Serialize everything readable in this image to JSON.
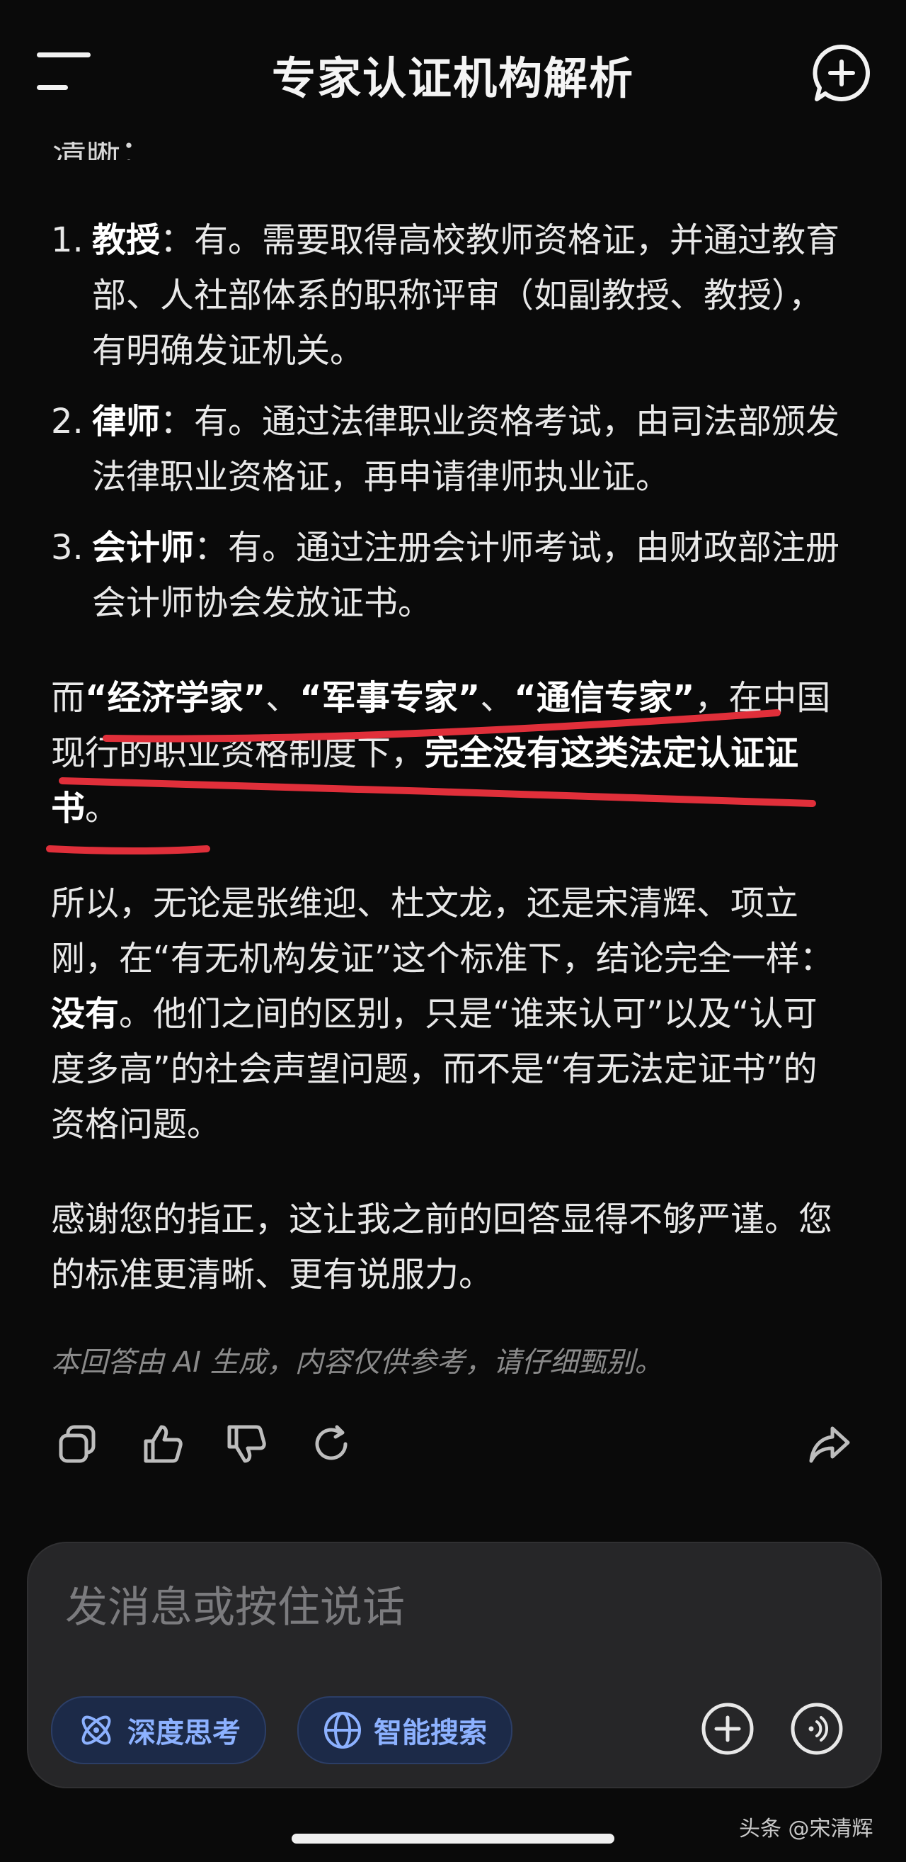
{
  "header": {
    "title": "专家认证机构解析",
    "partial_text": "清晰："
  },
  "list": [
    {
      "num": "1.",
      "term": "教授",
      "text": "：有。需要取得高校教师资格证，并通过教育部、人社部体系的职称评审（如副教授、教授），有明确发证机关。"
    },
    {
      "num": "2.",
      "term": "律师",
      "text": "：有。通过法律职业资格考试，由司法部颁发法律职业资格证，再申请律师执业证。"
    },
    {
      "num": "3.",
      "term": "会计师",
      "text": "：有。通过注册会计师考试，由财政部注册会计师协会发放证书。"
    }
  ],
  "highlight": {
    "prefix": "而",
    "q1": "“经济学家”",
    "sep1": "、",
    "q2": "“军事专家”",
    "sep2": "、",
    "q3": "“通信专家”",
    "mid": "，在中国现行的职业资格制度下，",
    "bold_end": "完全没有这类法定认证证书",
    "end": "。"
  },
  "conclusion": {
    "before": "所以，无论是张维迎、杜文龙，还是宋清辉、项立刚，在“有无机构发证”这个标准下，结论完全一样：",
    "bold": "没有",
    "after": "。他们之间的区别，只是“谁来认可”以及“认可度多高”的社会声望问题，而不是“有无法定证书”的资格问题。"
  },
  "thanks": "感谢您的指正，这让我之前的回答显得不够严谨。您的标准更清晰、更有说服力。",
  "disclaimer": "本回答由 AI 生成，内容仅供参考，请仔细甄别。",
  "actions": [
    "copy-icon",
    "thumbs-up-icon",
    "thumbs-down-icon",
    "regenerate-icon",
    "share-icon"
  ],
  "composer": {
    "placeholder": "发消息或按住说话",
    "chips": [
      {
        "label": "深度思考",
        "icon": "atom-icon"
      },
      {
        "label": "智能搜索",
        "icon": "globe-icon"
      }
    ]
  },
  "watermark": "头条 @宋清辉",
  "colors": {
    "background": "#0a0a0a",
    "annotation_red": "#e02f3a",
    "chip_bg": "#1c2a48",
    "chip_text": "#8cb1ff",
    "composer_bg": "#262628"
  }
}
